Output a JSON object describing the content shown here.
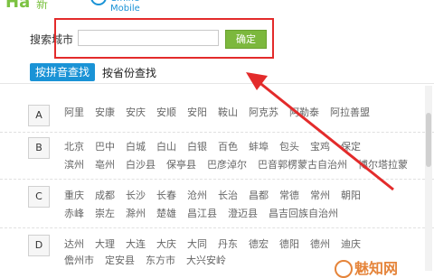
{
  "header": {
    "logo_text": "Ha",
    "logo_sub": "新",
    "brand_text": "Cfhine Mobile"
  },
  "search": {
    "label": "搜索城市",
    "value": "",
    "placeholder": "",
    "button_label": "确定"
  },
  "tabs": [
    {
      "label": "按拼音查找",
      "active": true
    },
    {
      "label": "按省份查找",
      "active": false
    }
  ],
  "sections": [
    {
      "letter": "A",
      "rows": [
        [
          "阿里",
          "安康",
          "安庆",
          "安顺",
          "安阳",
          "鞍山",
          "阿克苏",
          "阿勒泰",
          "阿拉善盟"
        ]
      ]
    },
    {
      "letter": "B",
      "rows": [
        [
          "北京",
          "巴中",
          "白城",
          "白山",
          "白银",
          "百色",
          "蚌埠",
          "包头",
          "宝鸡",
          "保定"
        ],
        [
          "滨州",
          "亳州",
          "白沙县",
          "保亭县",
          "巴彦淖尔",
          "巴音郭楞蒙古自治州",
          "博尔塔拉蒙"
        ]
      ]
    },
    {
      "letter": "C",
      "rows": [
        [
          "重庆",
          "成都",
          "长沙",
          "长春",
          "沧州",
          "长治",
          "昌都",
          "常德",
          "常州",
          "朝阳"
        ],
        [
          "赤峰",
          "崇左",
          "滁州",
          "楚雄",
          "昌江县",
          "澄迈县",
          "昌吉回族自治州"
        ]
      ]
    },
    {
      "letter": "D",
      "rows": [
        [
          "达州",
          "大理",
          "大连",
          "大庆",
          "大同",
          "丹东",
          "德宏",
          "德阳",
          "德州",
          "迪庆"
        ],
        [
          "儋州市",
          "定安县",
          "东方市",
          "大兴安岭"
        ]
      ]
    }
  ],
  "watermark": {
    "text": "魅知网"
  },
  "colors": {
    "accent_blue": "#1a93d6",
    "button_green": "#7cb83d",
    "highlight_red": "#e32b2b",
    "logo_green": "#7cc242",
    "watermark_orange": "#e5843a"
  }
}
